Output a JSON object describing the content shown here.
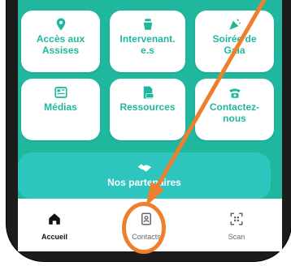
{
  "colors": {
    "teal": "#1fb89f",
    "partners_bg": "#2ec5bf",
    "orange": "#ef7f2f",
    "frame": "#1c1c1c"
  },
  "cards": [
    {
      "name": "acces-aux-assises",
      "label": "Accès aux\nAssises",
      "icon": "map-pin-icon"
    },
    {
      "name": "intervenants",
      "label": "Intervenant.\ne.s",
      "icon": "people-icon"
    },
    {
      "name": "soiree-de-gala",
      "label": "Soirée de\nGala",
      "icon": "party-icon"
    },
    {
      "name": "medias",
      "label": "Médias",
      "icon": "newspaper-icon"
    },
    {
      "name": "ressources",
      "label": "Ressources",
      "icon": "document-icon"
    },
    {
      "name": "contactez-nous",
      "label": "Contactez-\nnous",
      "icon": "phone-icon"
    }
  ],
  "partners": {
    "label": "Nos partenaires",
    "icon": "handshake-icon"
  },
  "tabs": [
    {
      "name": "accueil",
      "label": "Accueil",
      "icon": "home-icon",
      "active": true
    },
    {
      "name": "contacts",
      "label": "Contacts",
      "icon": "contacts-icon",
      "active": false
    },
    {
      "name": "scan",
      "label": "Scan",
      "icon": "qr-scan-icon",
      "active": false
    }
  ]
}
